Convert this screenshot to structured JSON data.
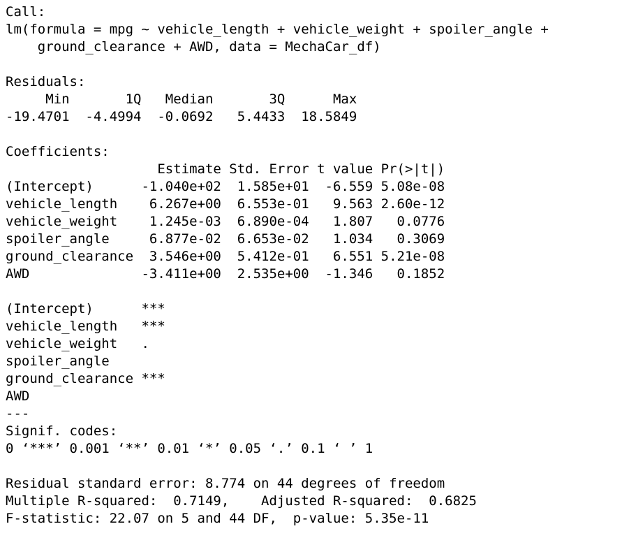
{
  "output_lines": [
    "Call:",
    "lm(formula = mpg ~ vehicle_length + vehicle_weight + spoiler_angle +",
    "    ground_clearance + AWD, data = MechaCar_df)",
    "",
    "Residuals:",
    "     Min       1Q   Median       3Q      Max ",
    "-19.4701  -4.4994  -0.0692   5.4433  18.5849 ",
    "",
    "Coefficients:",
    "                   Estimate Std. Error t value Pr(>|t|)",
    "(Intercept)      -1.040e+02  1.585e+01  -6.559 5.08e-08",
    "vehicle_length    6.267e+00  6.553e-01   9.563 2.60e-12",
    "vehicle_weight    1.245e-03  6.890e-04   1.807   0.0776",
    "spoiler_angle     6.877e-02  6.653e-02   1.034   0.3069",
    "ground_clearance  3.546e+00  5.412e-01   6.551 5.21e-08",
    "AWD              -3.411e+00  2.535e+00  -1.346   0.1852",
    "",
    "(Intercept)      ***",
    "vehicle_length   ***",
    "vehicle_weight   .  ",
    "spoiler_angle       ",
    "ground_clearance ***",
    "AWD                 ",
    "---",
    "Signif. codes:  ",
    "0 ‘***’ 0.001 ‘**’ 0.01 ‘*’ 0.05 ‘.’ 0.1 ‘ ’ 1",
    "",
    "Residual standard error: 8.774 on 44 degrees of freedom",
    "Multiple R-squared:  0.7149,\tAdjusted R-squared:  0.6825 ",
    "F-statistic: 22.07 on 5 and 44 DF,  p-value: 5.35e-11"
  ]
}
